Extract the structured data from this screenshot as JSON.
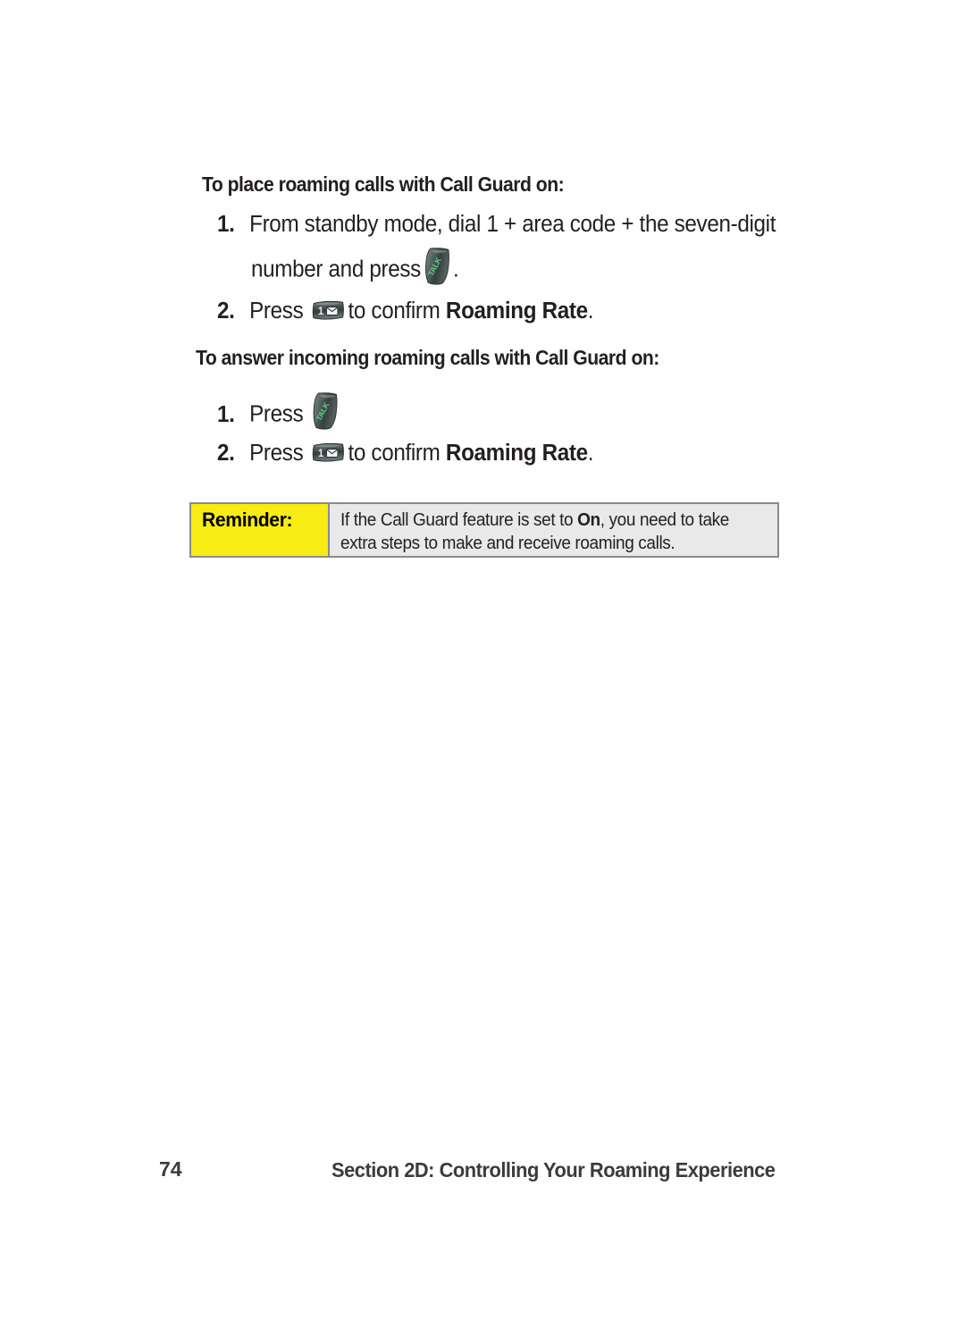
{
  "document": {
    "page_number": "74",
    "footer_title": "Section 2D: Controlling Your Roaming Experience"
  },
  "sections": [
    {
      "heading": "To place roaming calls with Call Guard on:",
      "steps": [
        {
          "number": "1.",
          "text_before": "From standby mode, dial 1 + area code + the seven-digit",
          "continuation_before": "number and press",
          "icon": "talk-key-icon",
          "continuation_after": "."
        },
        {
          "number": "2.",
          "text_before": "Press",
          "icon": "one-message-key-icon",
          "text_middle": "to confirm ",
          "text_bold": "Roaming Rate",
          "text_after": "."
        }
      ]
    },
    {
      "heading": "To answer incoming roaming calls with Call Guard on:",
      "steps": [
        {
          "number": "1.",
          "text_before": "Press",
          "icon": "talk-key-icon"
        },
        {
          "number": "2.",
          "text_before": "Press",
          "icon": "one-message-key-icon",
          "text_middle": "to confirm ",
          "text_bold": "Roaming Rate",
          "text_after": "."
        }
      ]
    }
  ],
  "reminder": {
    "label": "Reminder:",
    "line1_before": "If the Call Guard feature is set to ",
    "line1_bold": "On",
    "line1_after": ", you need to take",
    "line2": "extra steps to make and receive roaming calls."
  },
  "icons": {
    "talk_key_label": "TALK",
    "one_key_digit": "1",
    "one_key_symbol": "envelope"
  },
  "colors": {
    "reminder_label_bg": "#f7ec13",
    "reminder_body_bg": "#e9e9e9",
    "reminder_border": "#8a8a8a",
    "text": "#231f20",
    "footer_text": "#3b3b3b",
    "key_body_dark": "#3f4a49",
    "key_body_light": "#8e9a99",
    "talk_label_green": "#5ed07a"
  }
}
